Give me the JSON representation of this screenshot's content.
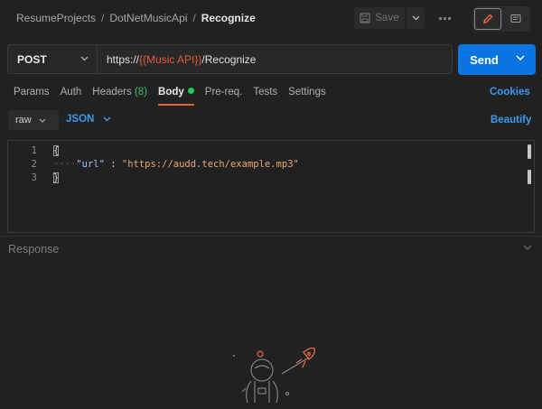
{
  "breadcrumb": {
    "items": [
      "ResumeProjects",
      "DotNetMusicApi"
    ],
    "separator": "/",
    "current": "Recognize"
  },
  "toolbar": {
    "save_label": "Save",
    "icons": {
      "save": "save-icon",
      "save_caret": "chevron-down-icon",
      "more": "more-dots-icon",
      "edit": "pencil-icon",
      "comment": "comment-icon"
    }
  },
  "request": {
    "method": "POST",
    "url_prefix": "https://",
    "url_variable": "{{Music API}}",
    "url_suffix": "/Recognize",
    "send_label": "Send"
  },
  "tabs": [
    {
      "label": "Params"
    },
    {
      "label": "Auth"
    },
    {
      "label": "Headers",
      "count": "(8)"
    },
    {
      "label": "Body",
      "active": true,
      "has_dot": true
    },
    {
      "label": "Pre-req."
    },
    {
      "label": "Tests"
    },
    {
      "label": "Settings"
    }
  ],
  "links": {
    "cookies": "Cookies",
    "beautify": "Beautify"
  },
  "body_options": {
    "mode": "raw",
    "language": "JSON"
  },
  "editor": {
    "line_numbers": [
      "1",
      "2",
      "3"
    ],
    "line1": "{",
    "line2_key": "\"url\"",
    "line2_sep": " : ",
    "line2_value": "\"https://audd.tech/example.mp3\"",
    "line3": "}"
  },
  "response": {
    "label": "Response"
  },
  "colors": {
    "background": "#212121",
    "accent_blue": "#0a74e0",
    "active_tab_underline": "#e8633d",
    "variable": "#e05a3a",
    "status_dot": "#27c45f"
  }
}
